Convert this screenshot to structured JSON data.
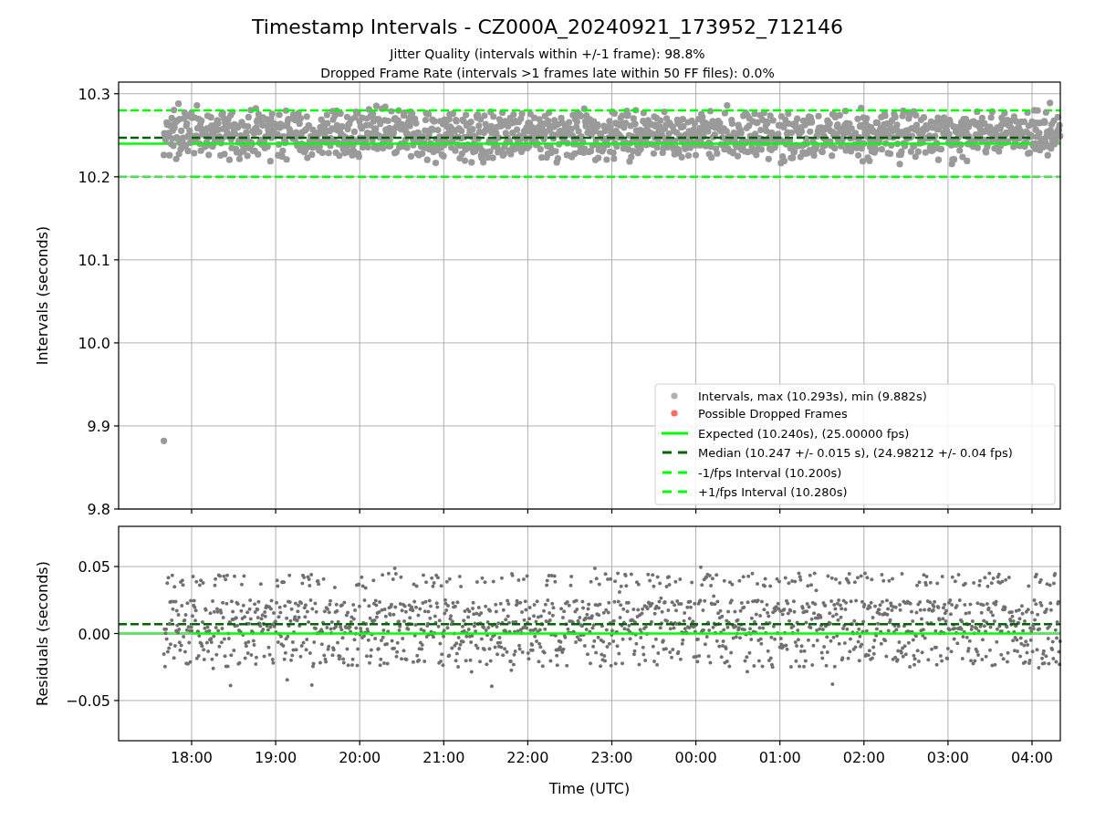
{
  "figure": {
    "title": "Timestamp Intervals - CZ000A_20240921_173952_712146",
    "subtitles": [
      "Jitter Quality (intervals within +/-1 frame): 98.8%",
      "Dropped Frame Rate (intervals >1 frames late within 50 FF files): 0.0%"
    ]
  },
  "intervals_panel": {
    "chart_data": {
      "type": "line",
      "ylabel": "Intervals (seconds)",
      "grid": true,
      "ylim": [
        9.8,
        10.314
      ],
      "categories": [
        null,
        null,
        null,
        null,
        null,
        null,
        null,
        null,
        null,
        null,
        null
      ],
      "yticks": [
        {
          "value": 9.8,
          "label": "9.8"
        },
        {
          "value": 9.9,
          "label": "9.9"
        },
        {
          "value": 10.0,
          "label": "10.0"
        },
        {
          "value": 10.1,
          "label": "10.1"
        },
        {
          "value": 10.2,
          "label": "10.2"
        },
        {
          "value": 10.3,
          "label": "10.3"
        }
      ],
      "series": [
        {
          "color": "#00ff00",
          "line_style": "solid",
          "values": [
            10.24,
            10.24,
            10.24,
            10.24,
            10.24,
            10.24,
            10.24,
            10.24,
            10.24,
            10.24,
            10.24
          ]
        },
        {
          "color": "#006400",
          "line_style": "dashed",
          "values": [
            10.247,
            10.247,
            10.247,
            10.247,
            10.247,
            10.247,
            10.247,
            10.247,
            10.247,
            10.247,
            10.247
          ]
        },
        {
          "color": "#00ff00",
          "line_style": "dashed",
          "values": [
            10.2,
            10.2,
            10.2,
            10.2,
            10.2,
            10.2,
            10.2,
            10.2,
            10.2,
            10.2,
            10.2
          ]
        },
        {
          "color": "#00ff00",
          "line_style": "dashed",
          "values": [
            10.28,
            10.28,
            10.28,
            10.28,
            10.28,
            10.28,
            10.28,
            10.28,
            10.28,
            10.28,
            10.28
          ]
        }
      ]
    },
    "legend": [
      {
        "kind": "dot",
        "color": "#b0b0b0",
        "label": "Intervals, max (10.293s), min (9.882s)"
      },
      {
        "kind": "dot",
        "color": "#ff6a6a",
        "label": "Possible Dropped Frames"
      },
      {
        "kind": "solid",
        "color": "#00ff00",
        "label": "Expected (10.240s), (25.00000 fps)"
      },
      {
        "kind": "dashed",
        "color": "#006400",
        "label": "Median (10.247 +/- 0.015 s), (24.98212 +/- 0.04 fps)"
      },
      {
        "kind": "dashed",
        "color": "#00ff00",
        "label": "-1/fps Interval (10.200s)"
      },
      {
        "kind": "dashed",
        "color": "#00ff00",
        "label": "+1/fps Interval (10.280s)"
      }
    ]
  },
  "residuals_panel": {
    "chart_data": {
      "type": "line",
      "xlabel": "Time (UTC)",
      "ylabel": "Residuals (seconds)",
      "grid": true,
      "ylim": [
        -0.08,
        0.08
      ],
      "categories": [
        "18:00",
        "19:00",
        "20:00",
        "21:00",
        "22:00",
        "23:00",
        "00:00",
        "01:00",
        "02:00",
        "03:00",
        "04:00"
      ],
      "yticks": [
        {
          "value": -0.05,
          "label": "−0.05"
        },
        {
          "value": 0.0,
          "label": "0.00"
        },
        {
          "value": 0.05,
          "label": "0.05"
        }
      ],
      "series": [
        {
          "color": "#00ff00",
          "line_style": "solid",
          "values": [
            0,
            0,
            0,
            0,
            0,
            0,
            0,
            0,
            0,
            0,
            0
          ]
        },
        {
          "color": "#006400",
          "line_style": "dashed",
          "values": [
            0.007,
            0.007,
            0.007,
            0.007,
            0.007,
            0.007,
            0.007,
            0.007,
            0.007,
            0.007,
            0.007
          ]
        }
      ]
    }
  }
}
